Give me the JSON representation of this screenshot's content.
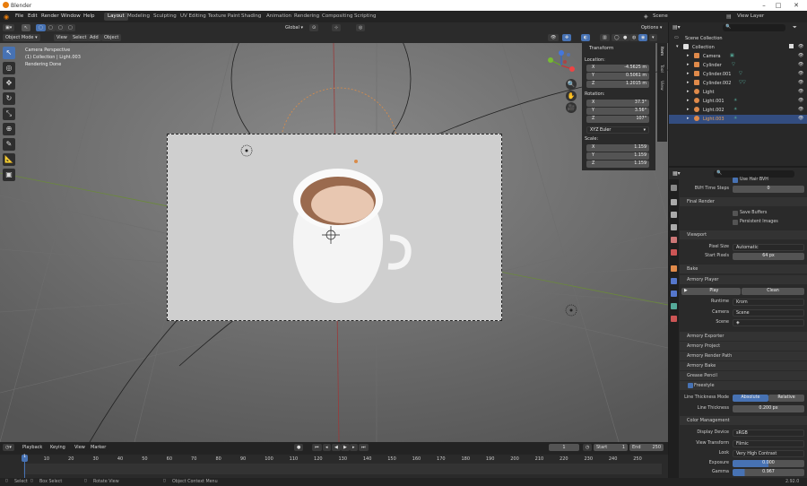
{
  "window": {
    "title": "Blender"
  },
  "menu": [
    "File",
    "Edit",
    "Render",
    "Window",
    "Help"
  ],
  "workspaces": [
    "Layout",
    "Modeling",
    "Sculpting",
    "UV Editing",
    "Texture Paint",
    "Shading",
    "Animation",
    "Rendering",
    "Compositing",
    "Scripting"
  ],
  "scene": {
    "label": "Scene",
    "view_layer": "View Layer"
  },
  "viewport_header": {
    "mode": "Object Mode",
    "menus": [
      "View",
      "Select",
      "Add",
      "Object"
    ],
    "orientation": "Global",
    "options": "Options"
  },
  "viewport_info": {
    "line1": "Camera Perspective",
    "line2": "(1) Collection | Light.003",
    "line3": "Rendering Done"
  },
  "n_panel": {
    "title": "Transform",
    "location_label": "Location:",
    "location": [
      {
        "axis": "X",
        "value": "-4.5625 m"
      },
      {
        "axis": "Y",
        "value": "0.5061 m"
      },
      {
        "axis": "Z",
        "value": "1.2015 m"
      }
    ],
    "rotation_label": "Rotation:",
    "rotation": [
      {
        "axis": "X",
        "value": "37.3°"
      },
      {
        "axis": "Y",
        "value": "3.56°"
      },
      {
        "axis": "Z",
        "value": "107°"
      }
    ],
    "rotation_mode": "XYZ Euler",
    "scale_label": "Scale:",
    "scale": [
      {
        "axis": "X",
        "value": "1.159"
      },
      {
        "axis": "Y",
        "value": "1.159"
      },
      {
        "axis": "Z",
        "value": "1.159"
      }
    ],
    "tabs": [
      "Item",
      "Tool",
      "View"
    ]
  },
  "outliner": {
    "root": "Scene Collection",
    "items": [
      {
        "name": "Collection",
        "color": "#e0e0e0"
      },
      {
        "name": "Camera",
        "color": "#e08a4a"
      },
      {
        "name": "Cylinder",
        "color": "#e08a4a"
      },
      {
        "name": "Cylinder.001",
        "color": "#e08a4a"
      },
      {
        "name": "Cylinder.002",
        "color": "#e08a4a"
      },
      {
        "name": "Light",
        "color": "#e08a4a"
      },
      {
        "name": "Light.001",
        "color": "#e08a4a"
      },
      {
        "name": "Light.002",
        "color": "#e08a4a"
      },
      {
        "name": "Light.003",
        "color": "#e08a4a"
      }
    ]
  },
  "properties": {
    "use_hair_bvh": "Use Hair BVH",
    "bvh_time_steps_label": "BVH Time Steps",
    "bvh_time_steps": "0",
    "final_render": "Final Render",
    "save_buffers": "Save Buffers",
    "persistent_images": "Persistent Images",
    "viewport": "Viewport",
    "pixel_size_label": "Pixel Size",
    "pixel_size": "Automatic",
    "start_pixels_label": "Start Pixels",
    "start_pixels": "64 px",
    "bake": "Bake",
    "armory_player": "Armory Player",
    "play": "Play",
    "clean": "Clean",
    "runtime_label": "Runtime",
    "runtime": "Krom",
    "camera_label": "Camera",
    "camera": "Scene",
    "scene_label": "Scene",
    "sections": [
      "Armory Exporter",
      "Armory Project",
      "Armory Render Path",
      "Armory Bake",
      "Grease Pencil"
    ],
    "freestyle": "Freestyle",
    "line_thickness_mode_label": "Line Thickness Mode",
    "absolute": "Absolute",
    "relative": "Relative",
    "line_thickness_label": "Line Thickness",
    "line_thickness": "0.200 px",
    "color_management": "Color Management",
    "display_device_label": "Display Device",
    "display_device": "sRGB",
    "view_transform_label": "View Transform",
    "view_transform": "Filmic",
    "look_label": "Look",
    "look": "Very High Contrast",
    "exposure_label": "Exposure",
    "exposure": "0.000",
    "gamma_label": "Gamma",
    "gamma": "0.967"
  },
  "timeline": {
    "menus": [
      "Playback",
      "Keying",
      "View",
      "Marker"
    ],
    "current_frame": "1",
    "start_label": "Start",
    "start": "1",
    "end_label": "End",
    "end": "250",
    "ticks": [
      "1",
      "10",
      "20",
      "30",
      "40",
      "50",
      "60",
      "70",
      "80",
      "90",
      "100",
      "110",
      "120",
      "130",
      "140",
      "150",
      "160",
      "170",
      "180",
      "190",
      "200",
      "210",
      "220",
      "230",
      "240",
      "250"
    ]
  },
  "statusbar": {
    "select": "Select",
    "box_select": "Box Select",
    "rotate_view": "Rotate View",
    "context_menu": "Object Context Menu",
    "version": "2.92.0"
  },
  "colors": {
    "accent": "#4772b3",
    "selected": "#334d80"
  }
}
